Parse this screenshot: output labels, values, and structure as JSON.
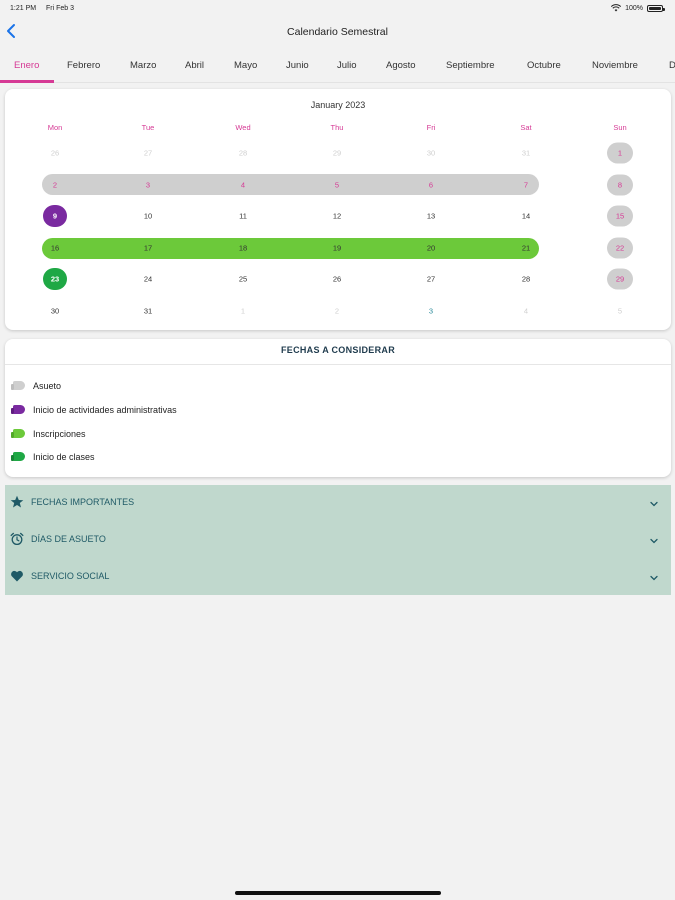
{
  "status_bar": {
    "time": "1:21 PM",
    "date": "Fri Feb 3",
    "battery": "100%"
  },
  "header": {
    "title": "Calendario Semestral"
  },
  "tabs": [
    {
      "label": "Enero",
      "active": true
    },
    {
      "label": "Febrero"
    },
    {
      "label": "Marzo"
    },
    {
      "label": "Abril"
    },
    {
      "label": "Mayo"
    },
    {
      "label": "Junio"
    },
    {
      "label": "Julio"
    },
    {
      "label": "Agosto"
    },
    {
      "label": "Septiembre"
    },
    {
      "label": "Octubre"
    },
    {
      "label": "Noviembre"
    },
    {
      "label": "D"
    }
  ],
  "calendar": {
    "title": "January 2023",
    "weekdays": [
      "Mon",
      "Tue",
      "Wed",
      "Thu",
      "Fri",
      "Sat",
      "Sun"
    ],
    "weeks": [
      [
        "26",
        "27",
        "28",
        "29",
        "30",
        "31",
        "1"
      ],
      [
        "2",
        "3",
        "4",
        "5",
        "6",
        "7",
        "8"
      ],
      [
        "9",
        "10",
        "11",
        "12",
        "13",
        "14",
        "15"
      ],
      [
        "16",
        "17",
        "18",
        "19",
        "20",
        "21",
        "22"
      ],
      [
        "23",
        "24",
        "25",
        "26",
        "27",
        "28",
        "29"
      ],
      [
        "30",
        "31",
        "1",
        "2",
        "3",
        "4",
        "5"
      ]
    ]
  },
  "legend": {
    "title": "FECHAS A CONSIDERAR",
    "items": [
      {
        "label": "Asueto",
        "color": "#cfcfcf"
      },
      {
        "label": "Inicio de actividades administrativas",
        "color": "#7a2aa0"
      },
      {
        "label": "Inscripciones",
        "color": "#6cc93a"
      },
      {
        "label": "Inicio de clases",
        "color": "#1fa845"
      }
    ]
  },
  "accordion": [
    {
      "label": "FECHAS IMPORTANTES",
      "icon": "star-icon"
    },
    {
      "label": "DÍAS DE ASUETO",
      "icon": "alarm-clock-icon"
    },
    {
      "label": "SERVICIO SOCIAL",
      "icon": "heart-icon"
    }
  ],
  "colors": {
    "accent": "#d63a95",
    "holiday_gray": "#cfcfcf",
    "admin_purple": "#7a2aa0",
    "registration_green": "#6cc93a",
    "classes_green": "#1fa845",
    "accordion_bg": "#c0d8cd",
    "accordion_text": "#1f5a66"
  }
}
